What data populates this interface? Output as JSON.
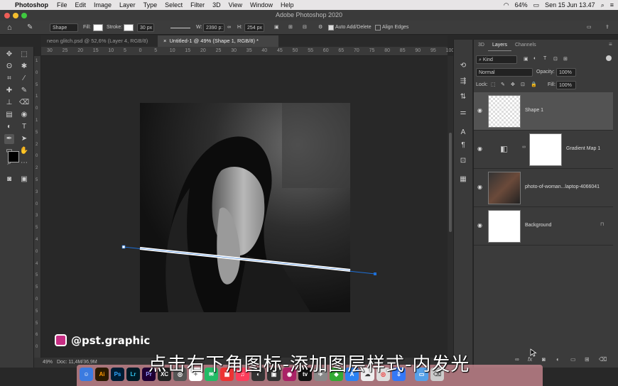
{
  "menubar": {
    "app": "Photoshop",
    "items": [
      "File",
      "Edit",
      "Image",
      "Layer",
      "Type",
      "Select",
      "Filter",
      "3D",
      "View",
      "Window",
      "Help"
    ],
    "battery": "64%",
    "clock": "Sen 15 Jun  13.47"
  },
  "window": {
    "title": "Adobe Photoshop 2020"
  },
  "options": {
    "mode": "Shape",
    "fill_label": "Fill:",
    "stroke_label": "Stroke:",
    "stroke_size": "30 px",
    "w_label": "W:",
    "w_value": "2390 p:",
    "h_label": "H:",
    "h_value": "254 px",
    "auto_add_delete": "Auto Add/Delete",
    "align_edges": "Align Edges"
  },
  "tabs": [
    {
      "label": "neon glitch.psd @ 52,6% (Layer 4, RGB/8) *"
    },
    {
      "label": "Untitled-1 @ 49% (Shape 1, RGB/8) *"
    }
  ],
  "ruler": {
    "h_ticks": [
      "30",
      "25",
      "20",
      "15",
      "10",
      "5",
      "0",
      "5",
      "10",
      "15",
      "20",
      "25",
      "30",
      "35",
      "40",
      "45",
      "50",
      "55",
      "60",
      "65",
      "70",
      "75",
      "80",
      "85",
      "90",
      "95",
      "100"
    ],
    "v_ticks": [
      "1",
      "0",
      "5",
      "1",
      "0",
      "1",
      "5",
      "2",
      "0",
      "2",
      "5",
      "3",
      "0",
      "3",
      "5",
      "4",
      "0",
      "4",
      "5",
      "5",
      "0",
      "5",
      "5",
      "6",
      "0"
    ]
  },
  "status": {
    "zoom": "49%",
    "doc": "Doc: 11,4M/36,9M"
  },
  "panel": {
    "tabs": [
      "3D",
      "Layers",
      "Channels"
    ],
    "kind": "Kind",
    "blend": "Normal",
    "opacity_label": "Opacity:",
    "opacity": "100%",
    "lock_label": "Lock:",
    "fill_label": "Fill:",
    "fill": "100%",
    "layers": [
      {
        "name": "Shape 1"
      },
      {
        "name": "Gradient Map 1"
      },
      {
        "name": "photo-of-woman...laptop-4066041"
      },
      {
        "name": "Background"
      }
    ]
  },
  "overlay": {
    "handle": "@pst.graphic",
    "subtitle": "点击右下角图标-添加图层样式-内发光"
  },
  "dock_icons": [
    "Ai",
    "Ps",
    "Lr",
    "Pr",
    "XC"
  ],
  "colors": {
    "accent": "#1e6fd6",
    "stroke": "#ffffff",
    "dock": "#d28c96"
  }
}
